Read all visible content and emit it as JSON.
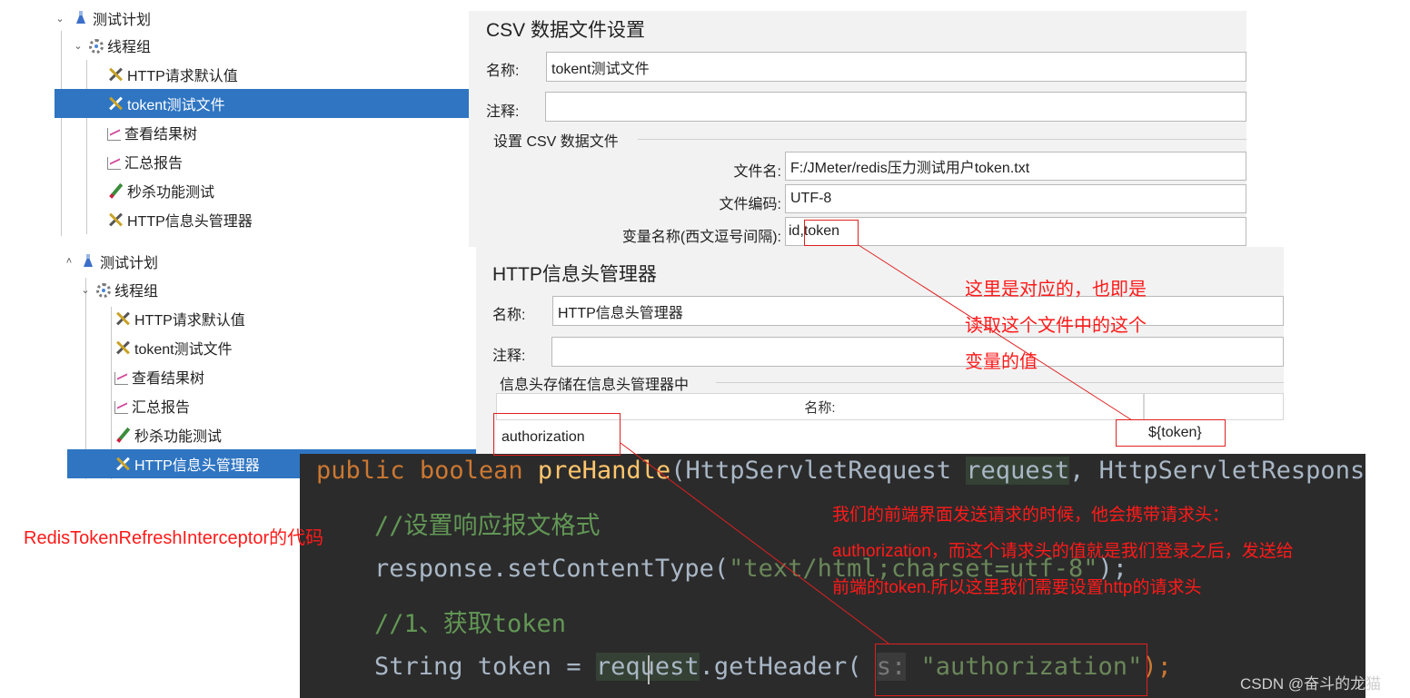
{
  "tree_top": {
    "items": [
      {
        "label": "测试计划",
        "icon": "test-plan-icon"
      },
      {
        "label": "线程组",
        "icon": "thread-group-icon"
      },
      {
        "label": "HTTP请求默认值",
        "icon": "config-tool-icon"
      },
      {
        "label": "tokent测试文件",
        "icon": "config-tool-icon",
        "selected": true
      },
      {
        "label": "查看结果树",
        "icon": "listener-chart-icon"
      },
      {
        "label": "汇总报告",
        "icon": "listener-chart-icon"
      },
      {
        "label": "秒杀功能测试",
        "icon": "sampler-pen-icon"
      },
      {
        "label": "HTTP信息头管理器",
        "icon": "config-tool-icon"
      }
    ]
  },
  "csv_panel": {
    "title": "CSV 数据文件设置",
    "name_label": "名称:",
    "name_value": "tokent测试文件",
    "comment_label": "注释:",
    "comment_value": "",
    "group_title": "设置 CSV 数据文件",
    "filename_label": "文件名:",
    "filename_value": "F:/JMeter/redis压力测试用户token.txt",
    "encoding_label": "文件编码:",
    "encoding_value": "UTF-8",
    "varnames_label": "变量名称(西文逗号间隔):",
    "varnames_value": "id,token"
  },
  "tree_bottom": {
    "items": [
      {
        "label": "测试计划",
        "icon": "test-plan-icon"
      },
      {
        "label": "线程组",
        "icon": "thread-group-icon"
      },
      {
        "label": "HTTP请求默认值",
        "icon": "config-tool-icon"
      },
      {
        "label": "tokent测试文件",
        "icon": "config-tool-icon"
      },
      {
        "label": "查看结果树",
        "icon": "listener-chart-icon"
      },
      {
        "label": "汇总报告",
        "icon": "listener-chart-icon"
      },
      {
        "label": "秒杀功能测试",
        "icon": "sampler-pen-icon"
      },
      {
        "label": "HTTP信息头管理器",
        "icon": "config-tool-icon",
        "selected": true
      }
    ]
  },
  "header_panel": {
    "title": "HTTP信息头管理器",
    "name_label": "名称:",
    "name_value": "HTTP信息头管理器",
    "comment_label": "注释:",
    "comment_value": "",
    "group_title": "信息头存储在信息头管理器中",
    "column_name": "名称:",
    "row_name": "authorization",
    "row_value": "${token}"
  },
  "code": {
    "line1": {
      "kw1": "public",
      "kw2": "boolean",
      "fn": "preHandle",
      "p1": "(HttpServletRequest ",
      "hl": "request",
      "p2": ", HttpServletResponse"
    },
    "line2": "//设置响应报文格式",
    "line3": {
      "a": "response.setContentType(",
      "s": "\"text/html;charset=utf-8\"",
      "b": ");"
    },
    "line4": "//1、获取token",
    "line5": {
      "a": "String token = ",
      "hl": "request",
      "b": ".getHeader( ",
      "hint": "s:",
      "s": " \"authorization\"",
      "c": ");"
    }
  },
  "annotations": {
    "note_mapping_1": "这里是对应的，也即是",
    "note_mapping_2": "读取这个文件中的这个",
    "note_mapping_3": "变量的值",
    "note_interceptor": "RedisTokenRefreshInterceptor的代码",
    "note_explain_1": "我们的前端界面发送请求的时候，他会携带请求头：",
    "note_explain_2": "authorization，而这个请求头的值就是我们登录之后，发送给",
    "note_explain_3": "前端的token.所以这里我们需要设置http的请求头",
    "accent_color": "#ff1a1a"
  },
  "watermark": "CSDN @奋斗的龙猫"
}
